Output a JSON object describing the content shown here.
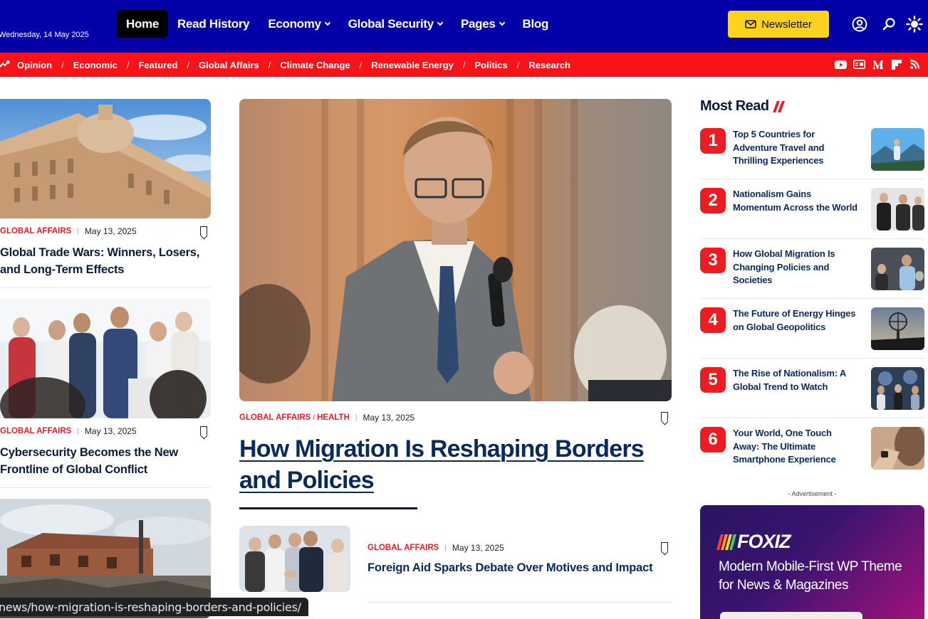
{
  "header": {
    "date": "Wednesday, 14 May 2025",
    "nav": [
      {
        "label": "Home",
        "active": true,
        "dropdown": false
      },
      {
        "label": "Read History",
        "active": false,
        "dropdown": false
      },
      {
        "label": "Economy",
        "active": false,
        "dropdown": true
      },
      {
        "label": "Global Security",
        "active": false,
        "dropdown": true
      },
      {
        "label": "Pages",
        "active": false,
        "dropdown": true
      },
      {
        "label": "Blog",
        "active": false,
        "dropdown": false
      }
    ],
    "newsletter_label": "Newsletter",
    "icons": [
      "user-icon",
      "search-icon",
      "theme-toggle-icon"
    ]
  },
  "subnav": {
    "trend_icon": "trending-icon",
    "items": [
      "Opinion",
      "Economic",
      "Featured",
      "Global Affairs",
      "Climate Change",
      "Renewable Energy",
      "Politics",
      "Research"
    ],
    "socials": [
      "youtube-icon",
      "google-news-icon",
      "medium-icon",
      "flipboard-icon",
      "rss-icon"
    ]
  },
  "left_posts": [
    {
      "category": "GLOBAL AFFAIRS",
      "date": "May 13, 2025",
      "title": "Global Trade Wars: Winners, Losers, and Long-Term Effects"
    },
    {
      "category": "GLOBAL AFFAIRS",
      "date": "May 13, 2025",
      "title": "Cybersecurity Becomes the New Frontline of Global Conflict"
    }
  ],
  "featured": {
    "categories": [
      "GLOBAL AFFAIRS",
      "HEALTH"
    ],
    "date": "May 13, 2025",
    "title": "How Migration Is Reshaping Borders and Policies"
  },
  "secondary": {
    "category": "GLOBAL AFFAIRS",
    "date": "May 13, 2025",
    "title": "Foreign Aid Sparks Debate Over Motives and Impact"
  },
  "most_read": {
    "title": "Most Read",
    "items": [
      {
        "num": "1",
        "title": "Top 5 Countries for Adventure Travel and Thrilling Experiences"
      },
      {
        "num": "2",
        "title": "Nationalism Gains Momentum Across the World"
      },
      {
        "num": "3",
        "title": "How Global Migration Is Changing Policies and Societies"
      },
      {
        "num": "4",
        "title": "The Future of Energy Hinges on Global Geopolitics"
      },
      {
        "num": "5",
        "title": "The Rise of Nationalism: A Global Trend to Watch"
      },
      {
        "num": "6",
        "title": "Your World, One Touch Away: The Ultimate Smartphone Experience"
      }
    ]
  },
  "ad": {
    "label": "- Advertisement -",
    "brand": "FOXIZ",
    "text": "Modern Mobile-First WP Theme for News & Magazines"
  },
  "status_url": "news/how-migration-is-reshaping-borders-and-policies/",
  "colors": {
    "nav_bg": "#0400a8",
    "subnav_bg": "#f71318",
    "accent": "#ee1b23",
    "newsletter_bg": "#ffd21e",
    "title": "#0b2a5c"
  }
}
